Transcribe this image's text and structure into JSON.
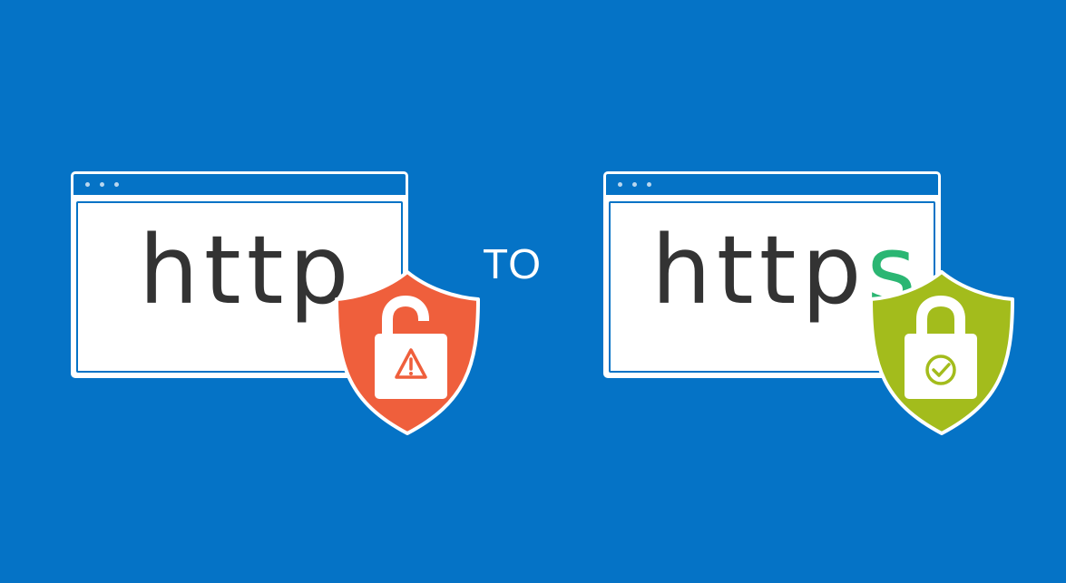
{
  "left_panel": {
    "protocol_text": "http"
  },
  "connector": {
    "label": "TO"
  },
  "right_panel": {
    "protocol_text": "http",
    "secure_letter": "s"
  },
  "colors": {
    "background": "#0573c6",
    "window": "#ffffff",
    "text": "#333333",
    "secure_letter": "#2bb673",
    "unsafe_shield": "#ef5f3c",
    "safe_shield": "#a3bc1c"
  },
  "icons": {
    "left_shield": "shield-warning-lock-icon",
    "right_shield": "shield-check-lock-icon"
  }
}
